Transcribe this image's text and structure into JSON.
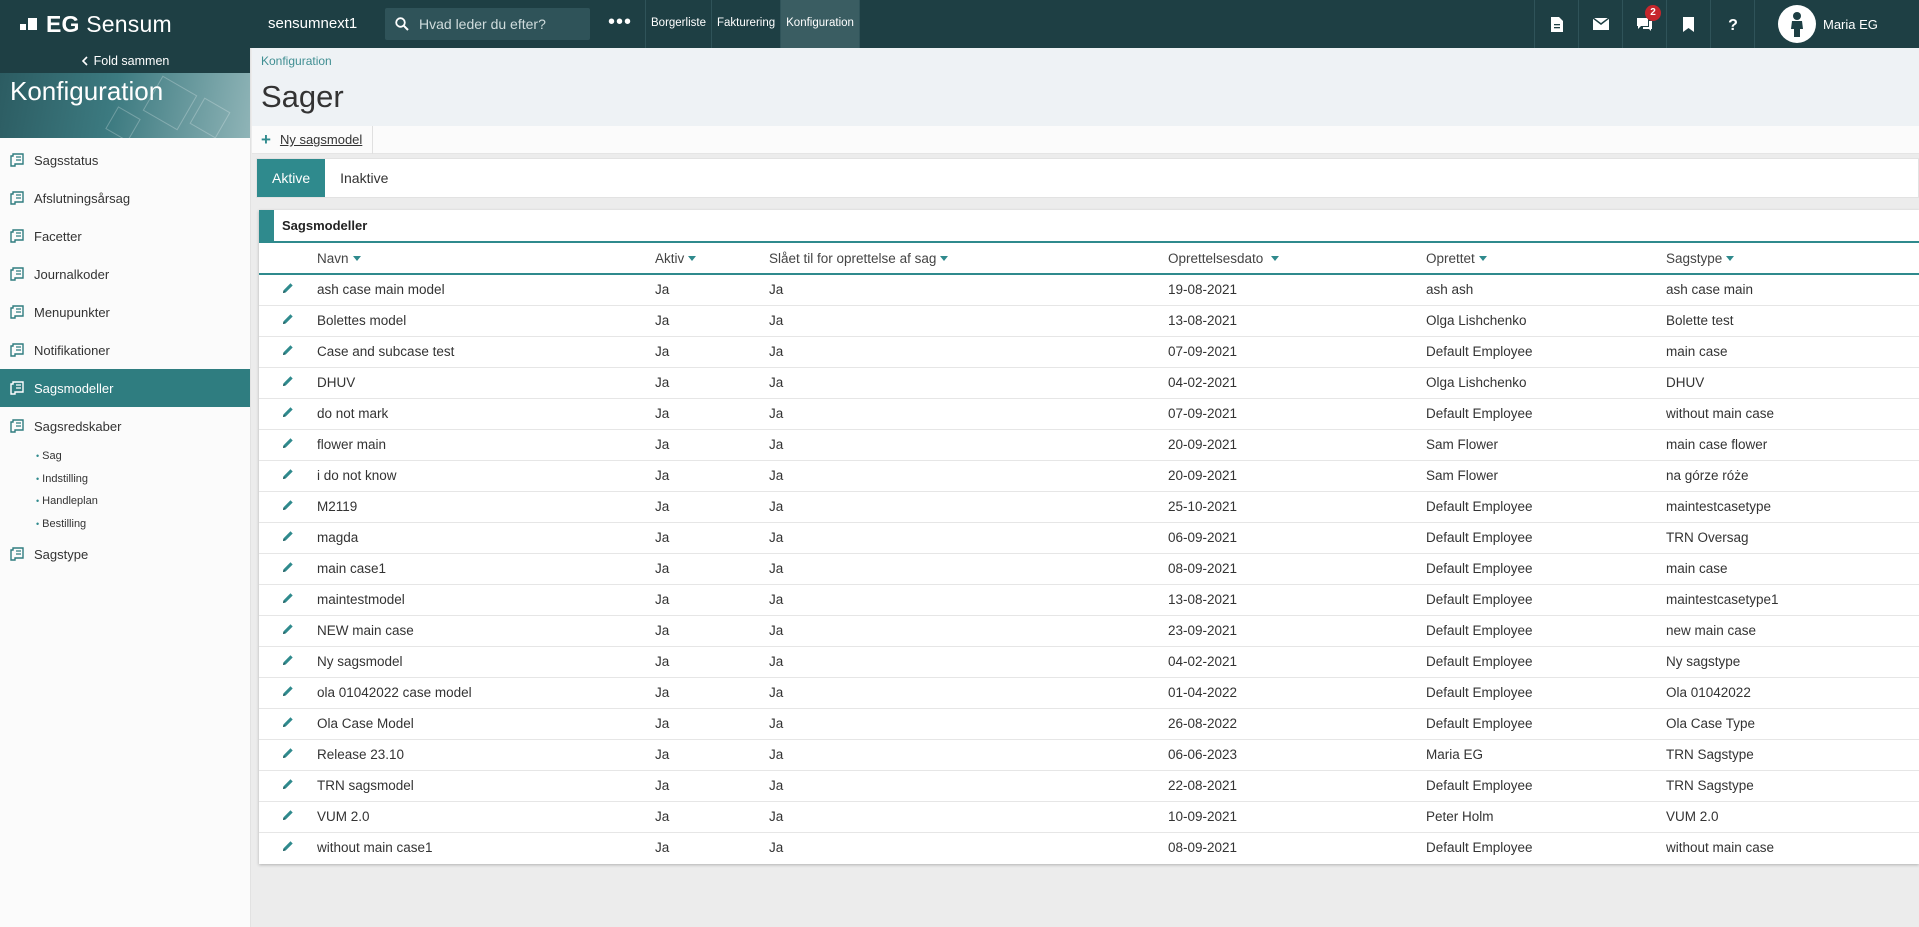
{
  "topbar": {
    "logo_bold": "EG",
    "logo_text": "Sensum",
    "instance": "sensumnext1",
    "search_placeholder": "Hvad leder du efter?",
    "more": "•••",
    "nav": [
      {
        "label": "Borgerliste",
        "active": false
      },
      {
        "label": "Fakturering",
        "active": false
      },
      {
        "label": "Konfiguration",
        "active": true
      }
    ],
    "notification_count": "2",
    "user_name": "Maria EG"
  },
  "sidebar": {
    "fold_label": "Fold sammen",
    "title": "Konfiguration",
    "items": [
      {
        "label": "Sagsstatus"
      },
      {
        "label": "Afslutningsårsag"
      },
      {
        "label": "Facetter"
      },
      {
        "label": "Journalkoder"
      },
      {
        "label": "Menupunkter"
      },
      {
        "label": "Notifikationer"
      },
      {
        "label": "Sagsmodeller"
      },
      {
        "label": "Sagsredskaber"
      }
    ],
    "sub_items": [
      "Sag",
      "Indstilling",
      "Handleplan",
      "Bestilling"
    ],
    "last_item": "Sagstype"
  },
  "page": {
    "breadcrumb": "Konfiguration",
    "title": "Sager",
    "new_button": "Ny sagsmodel",
    "tabs": [
      {
        "label": "Aktive",
        "active": true
      },
      {
        "label": "Inaktive",
        "active": false
      }
    ]
  },
  "table": {
    "title": "Sagsmodeller",
    "columns": [
      "Navn",
      "Aktiv",
      "Slået til for oprettelse af sag",
      "Oprettelsesdato",
      "Oprettet",
      "Sagstype"
    ],
    "rows": [
      [
        "ash case main model",
        "Ja",
        "Ja",
        "19-08-2021",
        "ash ash",
        "ash case main"
      ],
      [
        "Bolettes model",
        "Ja",
        "Ja",
        "13-08-2021",
        "Olga Lishchenko",
        "Bolette test"
      ],
      [
        "Case and subcase test",
        "Ja",
        "Ja",
        "07-09-2021",
        "Default Employee",
        "main case"
      ],
      [
        "DHUV",
        "Ja",
        "Ja",
        "04-02-2021",
        "Olga Lishchenko",
        "DHUV"
      ],
      [
        "do not mark",
        "Ja",
        "Ja",
        "07-09-2021",
        "Default Employee",
        "without main case"
      ],
      [
        "flower main",
        "Ja",
        "Ja",
        "20-09-2021",
        "Sam Flower",
        "main case flower"
      ],
      [
        "i do not know",
        "Ja",
        "Ja",
        "20-09-2021",
        "Sam Flower",
        "na górze róże"
      ],
      [
        "M2119",
        "Ja",
        "Ja",
        "25-10-2021",
        "Default Employee",
        "maintestcasetype"
      ],
      [
        "magda",
        "Ja",
        "Ja",
        "06-09-2021",
        "Default Employee",
        "TRN Oversag"
      ],
      [
        "main case1",
        "Ja",
        "Ja",
        "08-09-2021",
        "Default Employee",
        "main case"
      ],
      [
        "maintestmodel",
        "Ja",
        "Ja",
        "13-08-2021",
        "Default Employee",
        "maintestcasetype1"
      ],
      [
        "NEW main case",
        "Ja",
        "Ja",
        "23-09-2021",
        "Default Employee",
        "new main case"
      ],
      [
        "Ny sagsmodel",
        "Ja",
        "Ja",
        "04-02-2021",
        "Default Employee",
        "Ny sagstype"
      ],
      [
        "ola 01042022 case model",
        "Ja",
        "Ja",
        "01-04-2022",
        "Default Employee",
        "Ola 01042022"
      ],
      [
        "Ola Case Model",
        "Ja",
        "Ja",
        "26-08-2022",
        "Default Employee",
        "Ola Case Type"
      ],
      [
        "Release 23.10",
        "Ja",
        "Ja",
        "06-06-2023",
        "Maria EG",
        "TRN Sagstype"
      ],
      [
        "TRN sagsmodel",
        "Ja",
        "Ja",
        "22-08-2021",
        "Default Employee",
        "TRN Sagstype"
      ],
      [
        "VUM 2.0",
        "Ja",
        "Ja",
        "10-09-2021",
        "Peter Holm",
        "VUM 2.0"
      ],
      [
        "without main case1",
        "Ja",
        "Ja",
        "08-09-2021",
        "Default Employee",
        "without main case"
      ]
    ]
  },
  "icons": {
    "search": "search-icon",
    "document": "document-icon",
    "mail": "mail-icon",
    "chat": "chat-icon",
    "bookmark": "bookmark-icon",
    "help": "help-icon",
    "edit": "pencil-icon",
    "sidebar_item": "scroll-icon"
  },
  "colors": {
    "topbar": "#1e3f44",
    "accent": "#2f8a8d",
    "active_sidebar": "#2f7d80",
    "badge": "#c6262c"
  }
}
